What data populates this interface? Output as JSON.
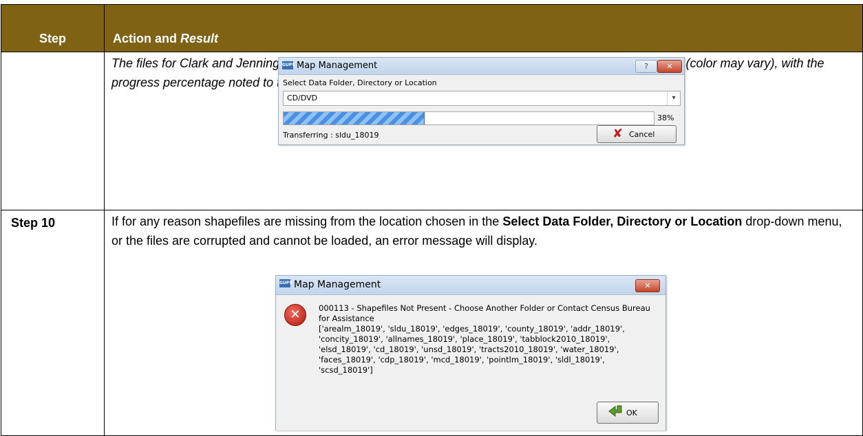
{
  "header": {
    "step": "Step",
    "action": "Action and ",
    "result": "Result"
  },
  "row1": {
    "step": "",
    "text": "The files for Clark and Jennings Counties begin to load and progress is displayed by the blue striped bar (color may vary), with the progress percentage noted to the right.",
    "dialog": {
      "title": "Map Management",
      "app_icon": "GUPS",
      "help_glyph": "?",
      "close_glyph": "✕",
      "label": "Select Data Folder, Directory or Location",
      "combo_value": "CD/DVD",
      "progress": 0.38,
      "progress_text": "38%",
      "status": "Transferring : sldu_18019",
      "cancel_label": "Cancel"
    }
  },
  "row2": {
    "step": "Step 10",
    "text_a": "If for any reason shapefiles are missing from the location chosen in the ",
    "text_b": "Select Data Folder, Directory or Location",
    "text_c": " drop-down menu, or the files are corrupted and cannot be loaded, an error message will display.",
    "dialog": {
      "title": "Map Management",
      "app_icon": "GUPS",
      "close_glyph": "✕",
      "error_glyph": "✕",
      "message": "000113 - Shapefiles Not Present - Choose Another Folder or Contact Census Bureau for Assistance\n['arealm_18019', 'sldu_18019', 'edges_18019', 'county_18019', 'addr_18019',\n'concity_18019', 'allnames_18019', 'place_18019', 'tabblock2010_18019',\n'elsd_18019', 'cd_18019', 'unsd_18019', 'tracts2010_18019', 'water_18019',\n'faces_18019', 'cdp_18019', 'mcd_18019', 'pointlm_18019', 'sldl_18019',\n'scsd_18019']",
      "ok_label": "OK"
    }
  },
  "colors": {
    "header_bg": "#7f6213",
    "progress_fill": "#4a90e2"
  },
  "icons": [
    "app-icon",
    "help-icon",
    "close-icon",
    "dropdown-arrow-icon",
    "cancel-icon",
    "error-icon",
    "ok-arrow-icon"
  ]
}
